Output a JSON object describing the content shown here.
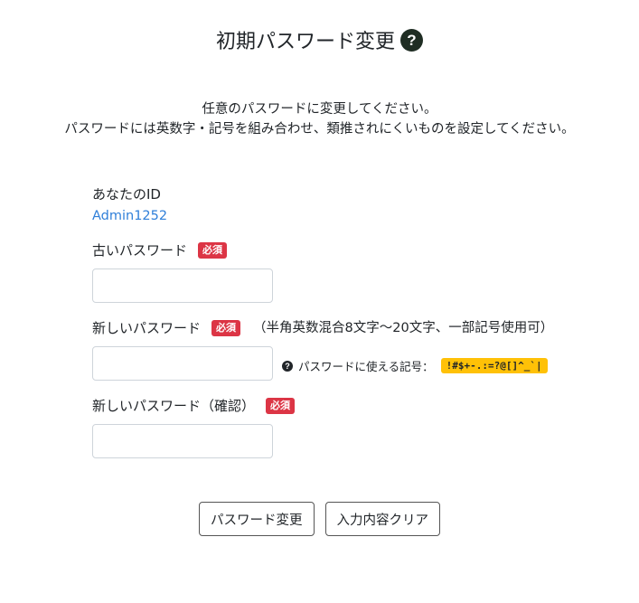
{
  "page": {
    "title": "初期パスワード変更",
    "help_icon": "question-circle-icon",
    "help_glyph": "?"
  },
  "intro": {
    "line1": "任意のパスワードに変更してください。",
    "line2": "パスワードには英数字・記号を組み合わせ、類推されにくいものを設定してください。"
  },
  "form": {
    "id_label": "あなたのID",
    "id_value": "Admin1252",
    "old_password_label": "古いパスワード",
    "new_password_label": "新しいパスワード",
    "new_password_note": "（半角英数混合8文字～20文字、一部記号使用可）",
    "confirm_password_label": "新しいパスワード（確認）",
    "required_badge": "必須",
    "hint_glyph": "?",
    "symbols_hint": "パスワードに使える記号：",
    "symbols": "!#$+-.:=?@[]^_`|"
  },
  "buttons": {
    "change": "パスワード変更",
    "clear": "入力内容クリア"
  },
  "colors": {
    "required_badge": "#dc3545",
    "symbols_badge": "#ffc107",
    "id_link": "#2f7fd9",
    "help_icon_bg": "#1f2d23"
  }
}
